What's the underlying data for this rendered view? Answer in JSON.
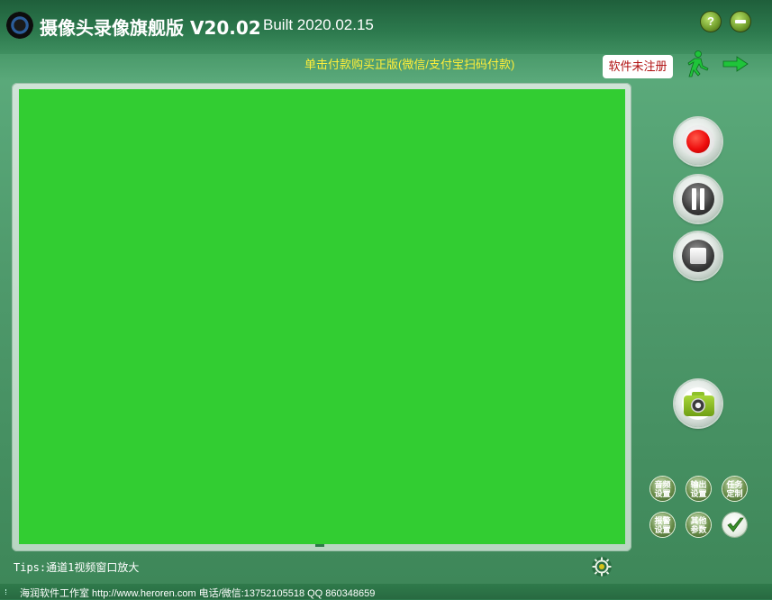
{
  "window": {
    "title": "摄像头录像旗舰版 V20.02",
    "build": "Built 2020.02.15",
    "help_label": "?"
  },
  "banner": {
    "buy_text": "单击付款购买正版(微信/支付宝扫码付款)",
    "registration_status": "软件未注册"
  },
  "preview": {
    "background_color": "#32CD32"
  },
  "controls": {
    "record": "record-icon",
    "pause": "pause-icon",
    "stop": "stop-icon",
    "snapshot": "camera-icon"
  },
  "settings": {
    "audio": "音频设置",
    "output": "输出设置",
    "task": "任务定制",
    "alarm": "报警设置",
    "other": "其他参数",
    "confirm_icon": "checkmark-icon"
  },
  "tips": "Tips:通道1视频窗口放大",
  "status_bar": {
    "text": "海润软件工作室 http://www.heroren.com  电话/微信:13752105518  QQ 860348659"
  }
}
